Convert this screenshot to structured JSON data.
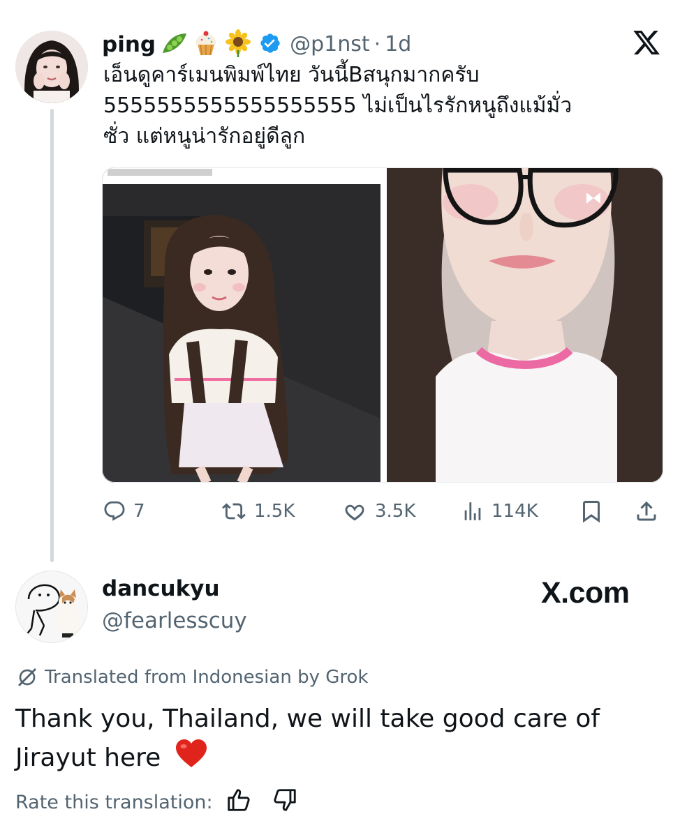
{
  "tweet": {
    "display_name": "ping",
    "name_emojis": [
      "pea-pod-emoji",
      "cupcake-emoji",
      "sunflower-emoji"
    ],
    "verified": true,
    "handle": "@p1nst",
    "separator": "·",
    "time": "1d",
    "text": "เอ็นดูคาร์เมนพิมพ์ไทย วันนี้Bสนุกมากครับ\n5555555555555555555 ไม่เป็นไรรักหนูถึงแม้มั่ว\nซั่ว แต่หนูน่ารักอยู่ดีลูก",
    "actions": {
      "replies": "7",
      "reposts": "1.5K",
      "likes": "3.5K",
      "views": "114K"
    }
  },
  "reply": {
    "display_name": "dancukyu",
    "handle": "@fearlesscuy",
    "watermark": "X.com",
    "translation_note": "Translated from Indonesian by Grok",
    "text": "Thank you, Thailand, we will take good care of Jirayut here",
    "text_emoji": "❤️",
    "rate_label": "Rate this translation:"
  },
  "icons": [
    "x-logo-icon",
    "verified-badge-icon",
    "reply-icon",
    "repost-icon",
    "like-icon",
    "views-icon",
    "bookmark-icon",
    "share-icon",
    "translate-icon",
    "thumbs-up-icon",
    "thumbs-down-icon"
  ],
  "colors": {
    "text": "#0f1419",
    "secondary": "#536471",
    "verified": "#1d9bf0",
    "thread_line": "#cfd9de",
    "heart": "#e0241b"
  }
}
